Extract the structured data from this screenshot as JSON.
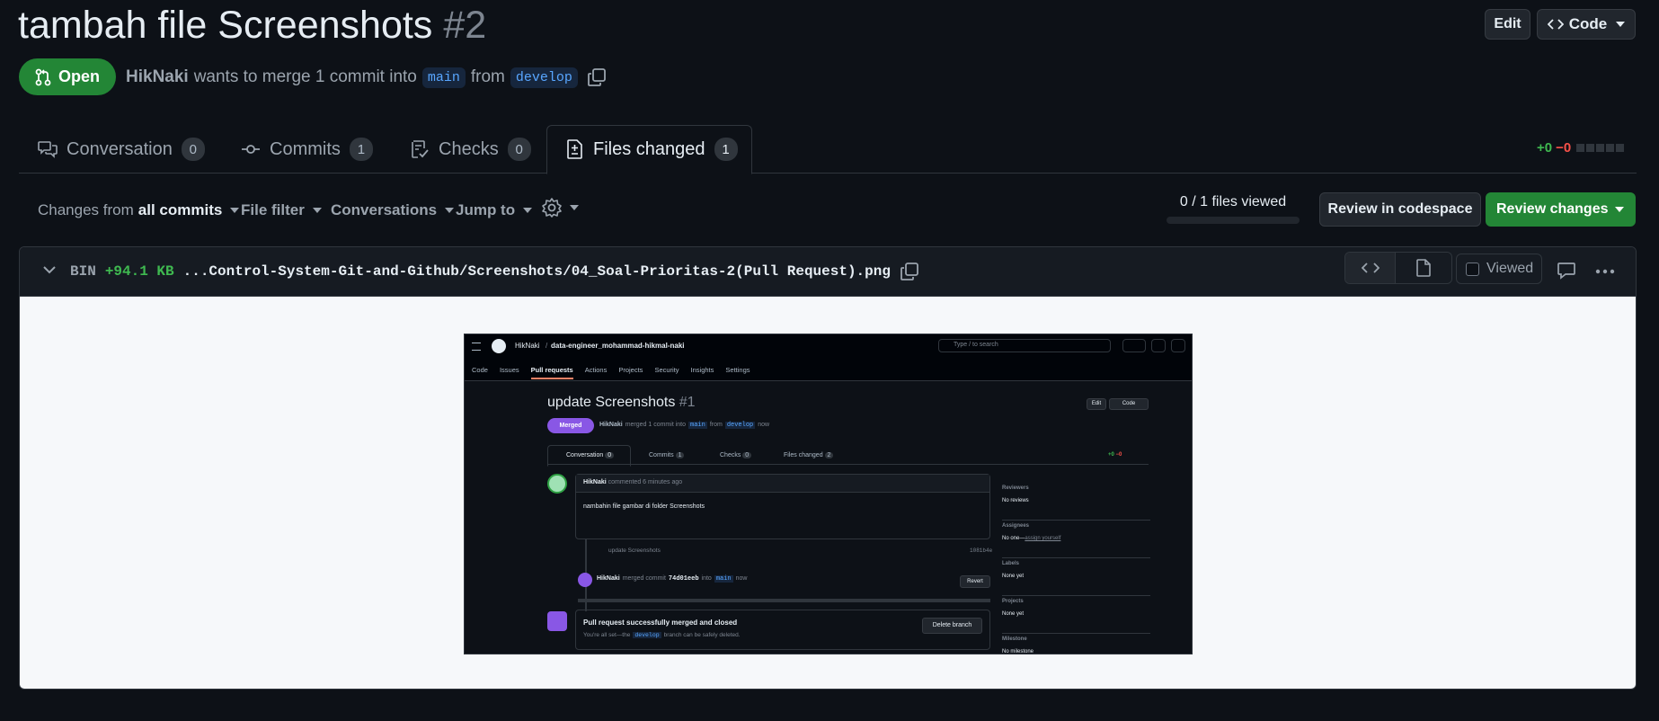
{
  "pr": {
    "title": "tambah file Screenshots",
    "number": "#2",
    "status": "Open",
    "author": "HikNaki",
    "merge_text": "wants to merge 1 commit into",
    "base_branch": "main",
    "from_text": "from",
    "head_branch": "develop"
  },
  "header_buttons": {
    "edit": "Edit",
    "code": "Code"
  },
  "tabs": [
    {
      "label": "Conversation",
      "count": "0"
    },
    {
      "label": "Commits",
      "count": "1"
    },
    {
      "label": "Checks",
      "count": "0"
    },
    {
      "label": "Files changed",
      "count": "1"
    }
  ],
  "diffstat": {
    "added": "+0",
    "removed": "−0"
  },
  "toolbar": {
    "changes_prefix": "Changes from",
    "changes_value": "all commits",
    "file_filter": "File filter",
    "conversations": "Conversations",
    "jump_to": "Jump to",
    "files_viewed": "0 / 1 files viewed",
    "review_codespace": "Review in codespace",
    "review_changes": "Review changes"
  },
  "file": {
    "type": "BIN",
    "size": "+94.1 KB",
    "path": "...Control-System-Git-and-Github/Screenshots/04_Soal-Prioritas-2(Pull Request).png",
    "viewed_label": "Viewed"
  },
  "preview": {
    "owner": "HikNaki",
    "sep": "/",
    "repo": "data-engineer_mohammad-hikmal-naki",
    "search_placeholder": "Type / to search",
    "nav": [
      "Code",
      "Issues",
      "Pull requests",
      "Actions",
      "Projects",
      "Security",
      "Insights",
      "Settings"
    ],
    "title": "update Screenshots",
    "number": "#1",
    "badge": "Merged",
    "merge_line_author": "HikNaki",
    "merge_line": "merged 1 commit into",
    "base": "main",
    "from": "from",
    "head": "develop",
    "when": "now",
    "edit": "Edit",
    "code": "Code",
    "tabs": [
      {
        "label": "Conversation",
        "count": "0"
      },
      {
        "label": "Commits",
        "count": "1"
      },
      {
        "label": "Checks",
        "count": "0"
      },
      {
        "label": "Files changed",
        "count": "2"
      }
    ],
    "diffstat": {
      "added": "+0",
      "removed": "−0"
    },
    "comment_author": "HikNaki",
    "comment_meta": "commented 6 minutes ago",
    "comment_body": "nambahin file gambar di folder Screenshots",
    "commit_msg": "update Screenshots",
    "commit_sha": "1081b4e",
    "merged_author": "HikNaki",
    "merged_text": "merged commit",
    "merged_sha": "74d01eeb",
    "merged_into": "into",
    "merged_base": "main",
    "merged_when": "now",
    "revert": "Revert",
    "closed_title": "Pull request successfully merged and closed",
    "closed_sub_pre": "You're all set—the",
    "closed_branch": "develop",
    "closed_sub_post": "branch can be safely deleted.",
    "delete_branch": "Delete branch",
    "sidebar": [
      {
        "label": "Reviewers",
        "value": "No reviews"
      },
      {
        "label": "Assignees",
        "value": "No one—",
        "link": "assign yourself"
      },
      {
        "label": "Labels",
        "value": "None yet"
      },
      {
        "label": "Projects",
        "value": "None yet"
      },
      {
        "label": "Milestone",
        "value": "No milestone"
      }
    ]
  },
  "colors": {
    "green": "#238636",
    "accent_blue": "#58a6ff",
    "purple": "#8957e5",
    "red": "#f85149",
    "added": "#3fb950"
  }
}
